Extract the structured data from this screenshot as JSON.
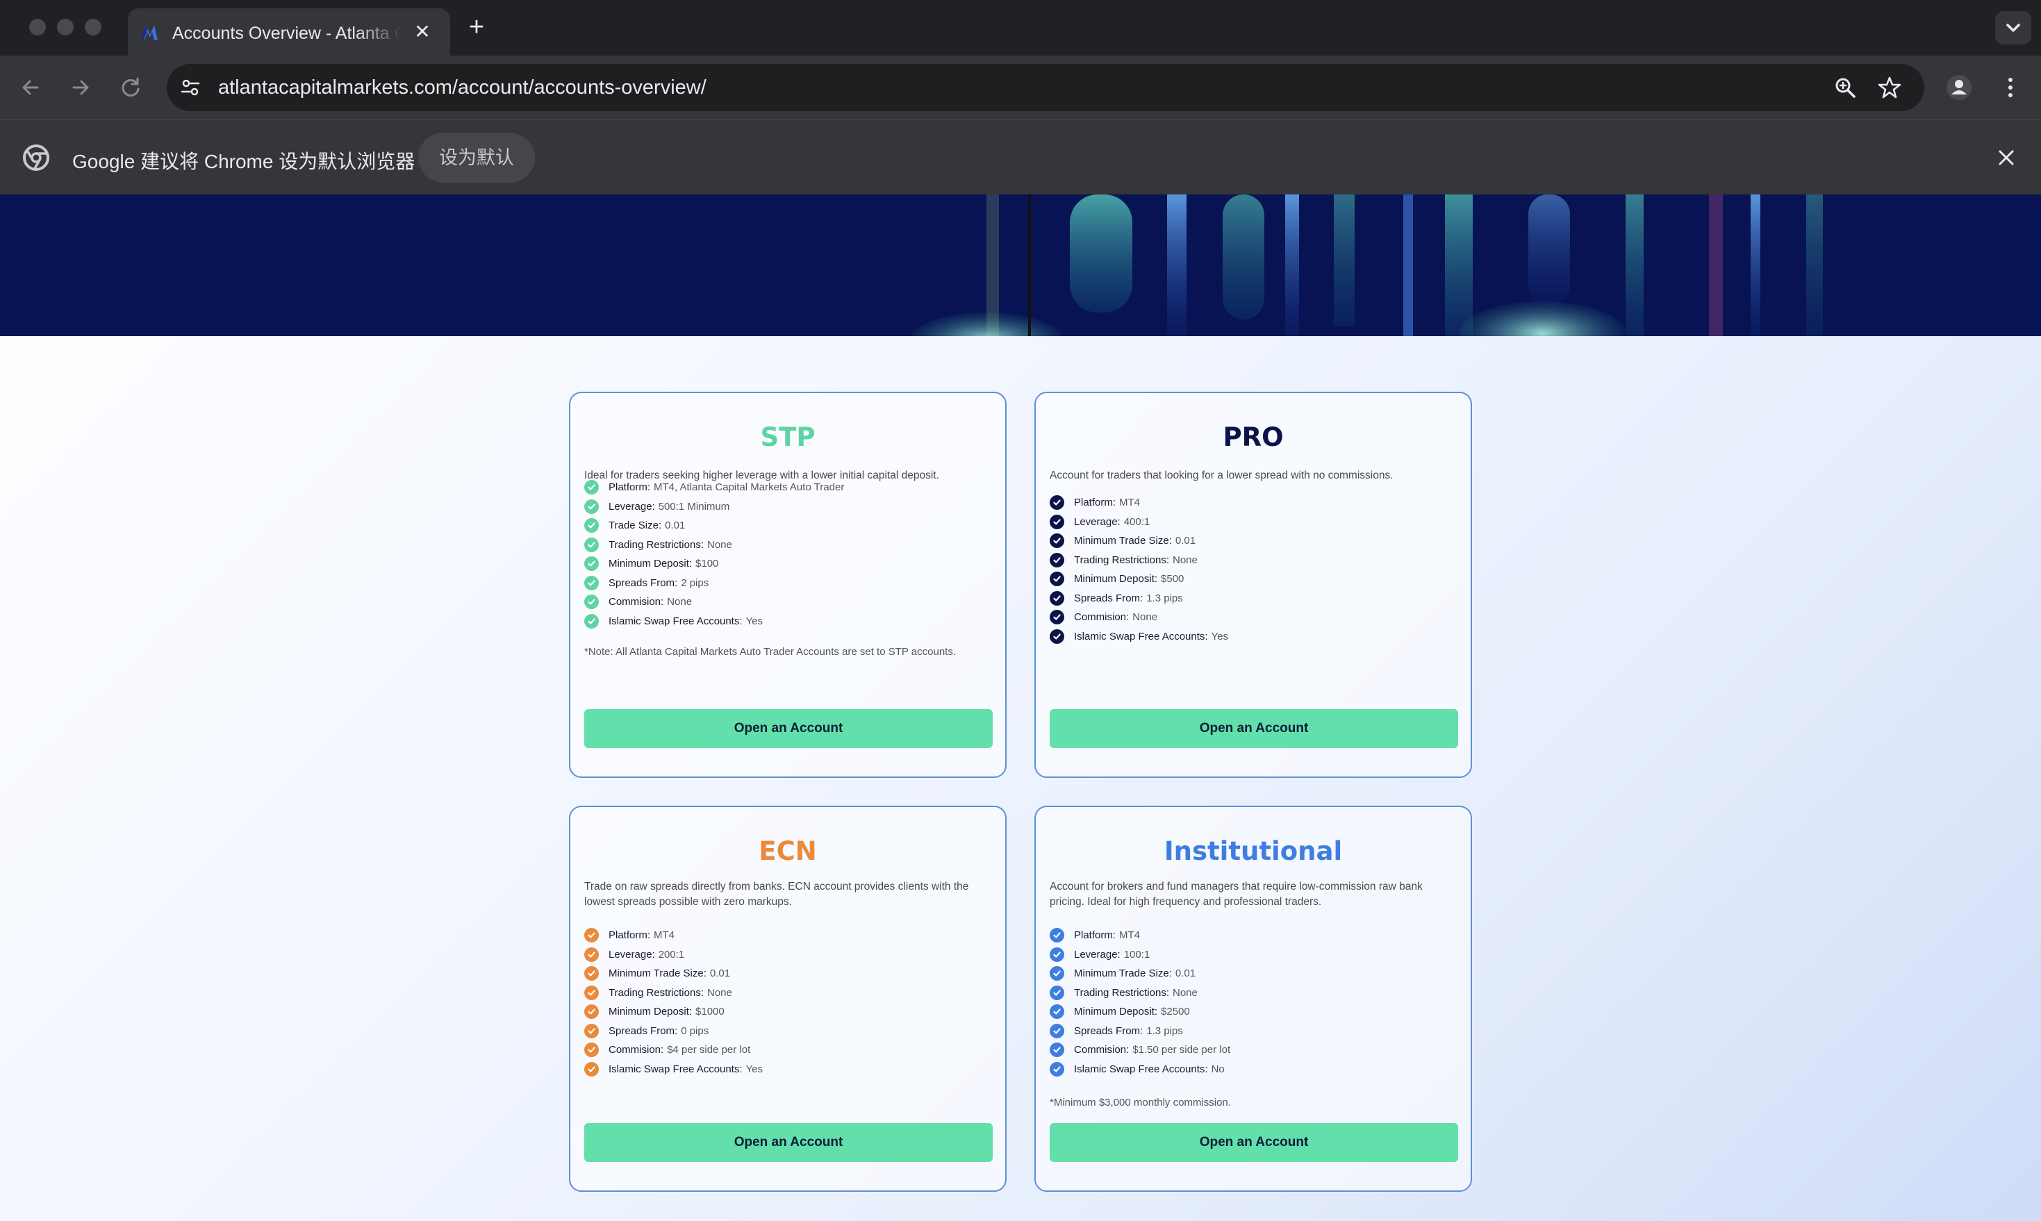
{
  "browser": {
    "tab_title": "Accounts Overview - Atlanta Capital Markets",
    "url": "atlantacapitalmarkets.com/account/accounts-overview/",
    "infobar_text": "Google 建议将 Chrome 设为默认浏览器",
    "infobar_button": "设为默认"
  },
  "colors": {
    "stp": "#5fd3a6",
    "pro": "#0b1448",
    "ecn": "#ea8a3a",
    "institutional": "#3f7ee0",
    "button_bg": "#62dfaa",
    "hero_bg": "#071353"
  },
  "cards": {
    "stp": {
      "title": "STP",
      "description": "Ideal for traders seeking higher leverage with a lower initial capital deposit.",
      "features": [
        {
          "label": "Platform:",
          "value": "MT4, Atlanta Capital Markets Auto Trader"
        },
        {
          "label": "Leverage:",
          "value": "500:1 Minimum"
        },
        {
          "label": "Trade Size:",
          "value": "0.01"
        },
        {
          "label": "Trading Restrictions:",
          "value": "None"
        },
        {
          "label": "Minimum Deposit:",
          "value": "$100"
        },
        {
          "label": "Spreads From:",
          "value": "2 pips"
        },
        {
          "label": "Commision:",
          "value": "None"
        },
        {
          "label": "Islamic Swap Free Accounts:",
          "value": "Yes"
        }
      ],
      "note": "*Note: All Atlanta Capital Markets Auto Trader Accounts are set to STP accounts.",
      "button": "Open an Account"
    },
    "pro": {
      "title": "PRO",
      "description": "Account for traders that looking for a lower spread with no commissions.",
      "features": [
        {
          "label": "Platform:",
          "value": "MT4"
        },
        {
          "label": "Leverage:",
          "value": "400:1"
        },
        {
          "label": "Minimum Trade Size:",
          "value": "0.01"
        },
        {
          "label": "Trading Restrictions:",
          "value": "None"
        },
        {
          "label": "Minimum Deposit:",
          "value": "$500"
        },
        {
          "label": "Spreads From:",
          "value": "1.3 pips"
        },
        {
          "label": "Commision:",
          "value": "None"
        },
        {
          "label": "Islamic Swap Free Accounts:",
          "value": "Yes"
        }
      ],
      "button": "Open an Account"
    },
    "ecn": {
      "title": "ECN",
      "description": "Trade on raw spreads directly from banks. ECN account provides clients with the lowest spreads possible with zero markups.",
      "features": [
        {
          "label": "Platform:",
          "value": "MT4"
        },
        {
          "label": "Leverage:",
          "value": "200:1"
        },
        {
          "label": "Minimum Trade Size:",
          "value": "0.01"
        },
        {
          "label": "Trading Restrictions:",
          "value": "None"
        },
        {
          "label": "Minimum Deposit:",
          "value": "$1000"
        },
        {
          "label": "Spreads From:",
          "value": "0 pips"
        },
        {
          "label": "Commision:",
          "value": "$4 per side per lot"
        },
        {
          "label": "Islamic Swap Free Accounts:",
          "value": "Yes"
        }
      ],
      "button": "Open an Account"
    },
    "institutional": {
      "title": "Institutional",
      "description": "Account for brokers and fund managers that require low-commission raw bank pricing. Ideal for high frequency and professional traders.",
      "features": [
        {
          "label": "Platform:",
          "value": "MT4"
        },
        {
          "label": "Leverage:",
          "value": "100:1"
        },
        {
          "label": "Minimum Trade Size:",
          "value": "0.01"
        },
        {
          "label": "Trading Restrictions:",
          "value": "None"
        },
        {
          "label": "Minimum Deposit:",
          "value": "$2500"
        },
        {
          "label": "Spreads From:",
          "value": "1.3 pips"
        },
        {
          "label": "Commision:",
          "value": "$1.50 per side per lot"
        },
        {
          "label": "Islamic Swap Free Accounts:",
          "value": "No"
        }
      ],
      "note": "*Minimum $3,000 monthly commission.",
      "button": "Open an Account"
    }
  }
}
